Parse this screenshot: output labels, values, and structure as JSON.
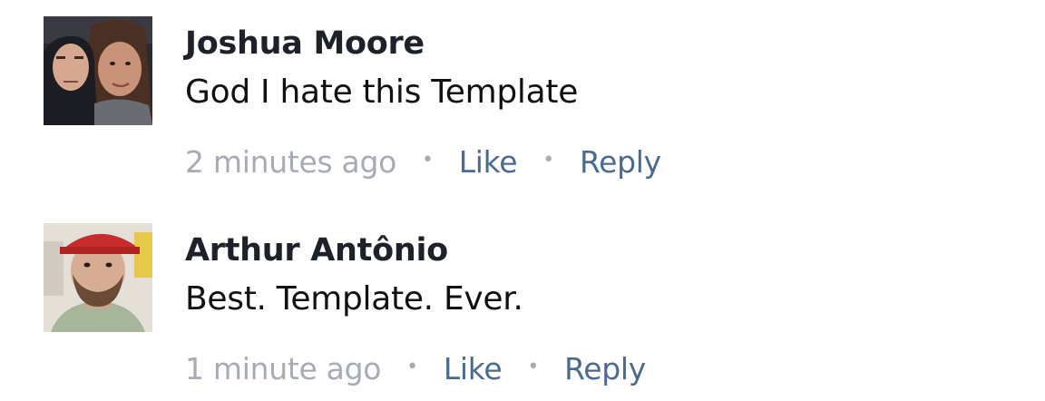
{
  "comments": [
    {
      "author": "Joshua Moore",
      "text": "God I hate this Template",
      "timestamp": "2 minutes ago",
      "like_label": "Like",
      "reply_label": "Reply",
      "separator": "•"
    },
    {
      "author": "Arthur Antônio",
      "text": "Best. Template. Ever.",
      "timestamp": "1 minute ago",
      "like_label": "Like",
      "reply_label": "Reply",
      "separator": "•"
    }
  ],
  "colors": {
    "author": "#1d2129",
    "text": "#111111",
    "timestamp": "#a7abb2",
    "action": "#4b6a92"
  }
}
